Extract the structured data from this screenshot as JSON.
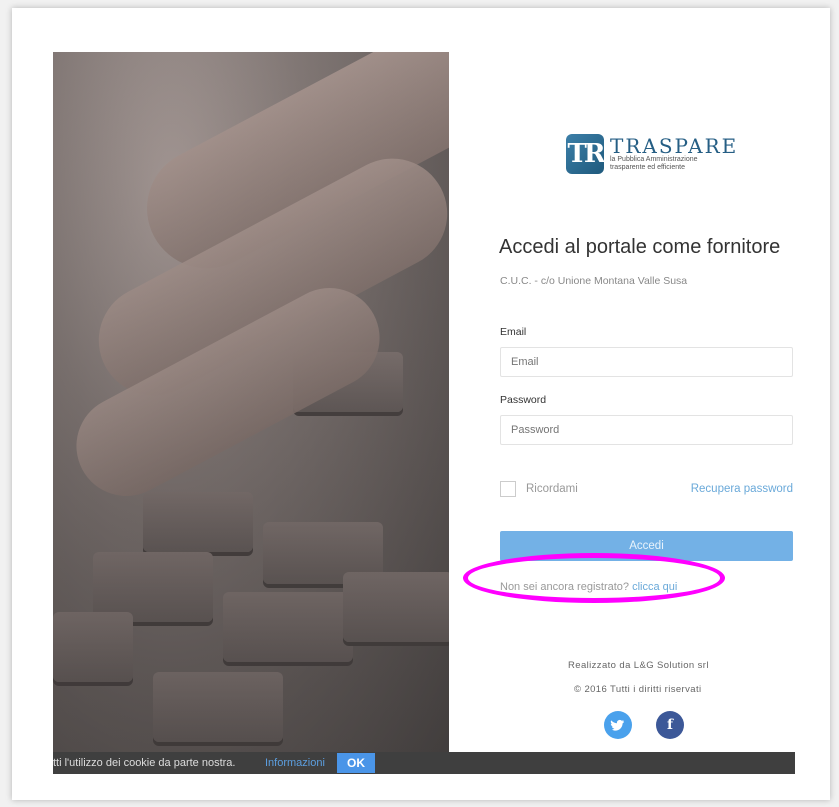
{
  "brand": {
    "logo_mark": "TR",
    "name": "TRASPARE",
    "tagline_1": "la Pubblica Amministrazione",
    "tagline_2": "trasparente ed efficiente",
    "color": "#255e84"
  },
  "login": {
    "title": "Accedi al portale come fornitore",
    "subtitle": "C.U.C. - c/o Unione Montana Valle Susa",
    "email_label": "Email",
    "email_placeholder": "Email",
    "password_label": "Password",
    "password_placeholder": "Password",
    "remember_label": "Ricordami",
    "remember_checked": false,
    "recover_link": "Recupera password",
    "submit_label": "Accedi",
    "register_text": "Non sei ancora registrato?",
    "register_link": "clicca qui"
  },
  "footer": {
    "credit": "Realizzato da L&G Solution srl",
    "copyright": "© 2016 Tutti i diritti riservati",
    "social": [
      "twitter-icon",
      "facebook-icon"
    ]
  },
  "cookie_bar": {
    "text": "tti l'utilizzo dei cookie da parte nostra.",
    "info_link": "Informazioni",
    "ok_button": "OK"
  },
  "colors": {
    "accent": "#73b1e6",
    "link": "#6aa9d9",
    "annotation": "#ff00ff"
  }
}
